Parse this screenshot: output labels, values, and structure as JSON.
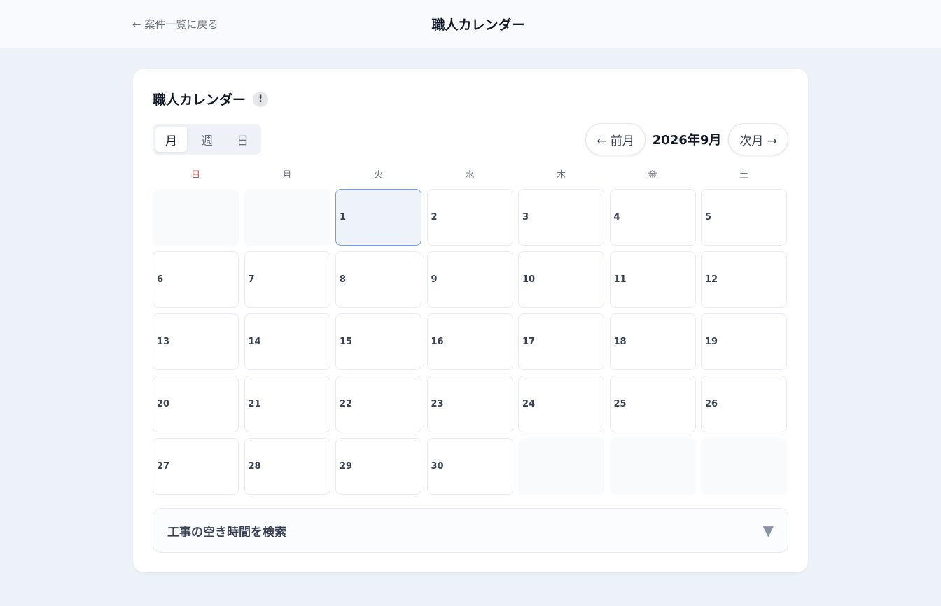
{
  "header": {
    "back_label": "← 案件一覧に戻る",
    "title": "職人カレンダー"
  },
  "card": {
    "title": "職人カレンダー",
    "info_badge": "!"
  },
  "view_toggle": {
    "month": "月",
    "week": "週",
    "day": "日",
    "active": "month"
  },
  "month_nav": {
    "prev_label": "← 前月",
    "current": "2026年9月",
    "next_label": "次月 →"
  },
  "weekdays": [
    "日",
    "月",
    "火",
    "水",
    "木",
    "金",
    "土"
  ],
  "calendar": {
    "leading_blanks": 2,
    "days_in_month": 30,
    "selected_day": 1,
    "trailing_blanks": 3
  },
  "search_panel": {
    "label": "工事の空き時間を検索",
    "caret": "▼"
  },
  "colors": {
    "sunday": "#e53e3e",
    "selected_border": "#7ba0c9",
    "selected_bg": "#eef3f9"
  }
}
